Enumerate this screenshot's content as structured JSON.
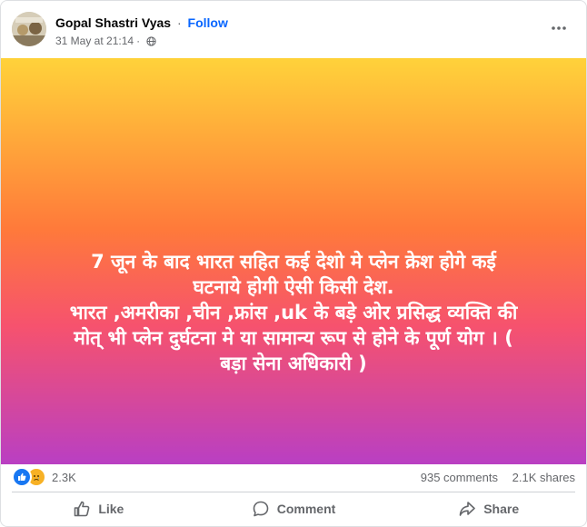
{
  "post": {
    "author": "Gopal Shastri Vyas",
    "separator": "·",
    "follow_label": "Follow",
    "timestamp": "31 May at 21:14",
    "timestamp_separator": "·",
    "privacy_icon": "globe-icon",
    "more_icon": "more-horizontal-icon",
    "background": {
      "top": "#ffd23a",
      "middle": "#ff7a3a",
      "lower": "#f6526e",
      "bottom": "#b93fc3"
    },
    "text_lines": [
      "7 जून के बाद भारत सहित कई देशो मे प्लेन क्रेश होगे कई",
      "घटनाये होगी ऐसी किसी देश.",
      "भारत ,अमरीका ,चीन ,फ्रांस ,uk के बड़े ओर प्रसिद्ध व्यक्ति की",
      "मोत् भी प्लेन दुर्घटना मे या सामान्य रूप से होने के पूर्ण योग । (",
      "बड़ा सेना अधिकारी )"
    ]
  },
  "engagement": {
    "reaction_icons": [
      "like-reaction-icon",
      "sad-reaction-icon"
    ],
    "reaction_count": "2.3K",
    "comments": "935 comments",
    "shares": "2.1K shares"
  },
  "actions": {
    "like_label": "Like",
    "comment_label": "Comment",
    "share_label": "Share"
  },
  "colors": {
    "accent": "#0866ff",
    "secondary_text": "#65676b",
    "like_blue": "#1877f2",
    "sad_yellow": "#f7b125"
  }
}
